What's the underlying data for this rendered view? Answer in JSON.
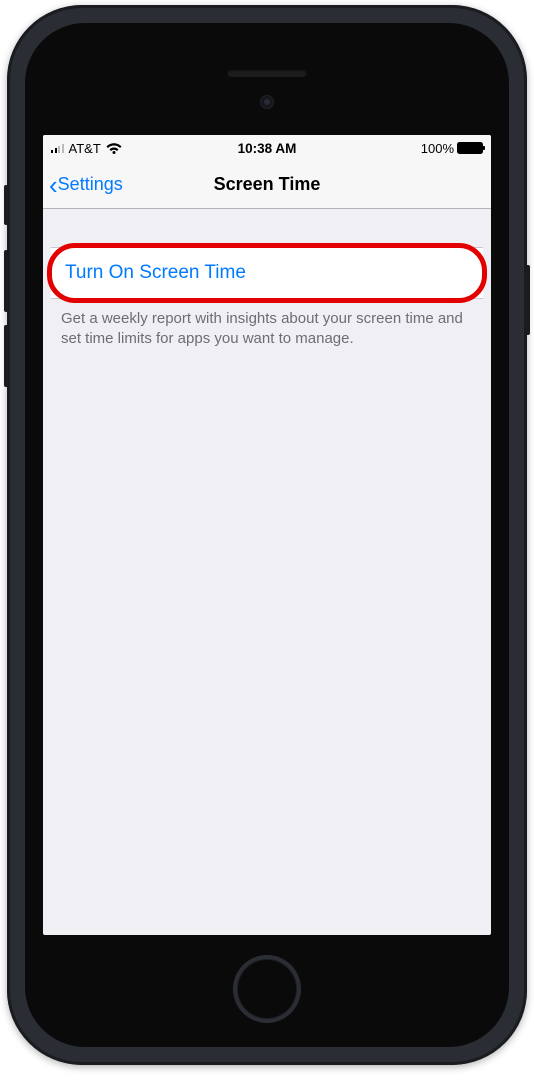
{
  "status_bar": {
    "carrier": "AT&T",
    "time": "10:38 AM",
    "battery_percent": "100%"
  },
  "nav": {
    "back_label": "Settings",
    "title": "Screen Time"
  },
  "main": {
    "turn_on_label": "Turn On Screen Time",
    "footer": "Get a weekly report with insights about your screen time and set time limits for apps you want to manage."
  }
}
